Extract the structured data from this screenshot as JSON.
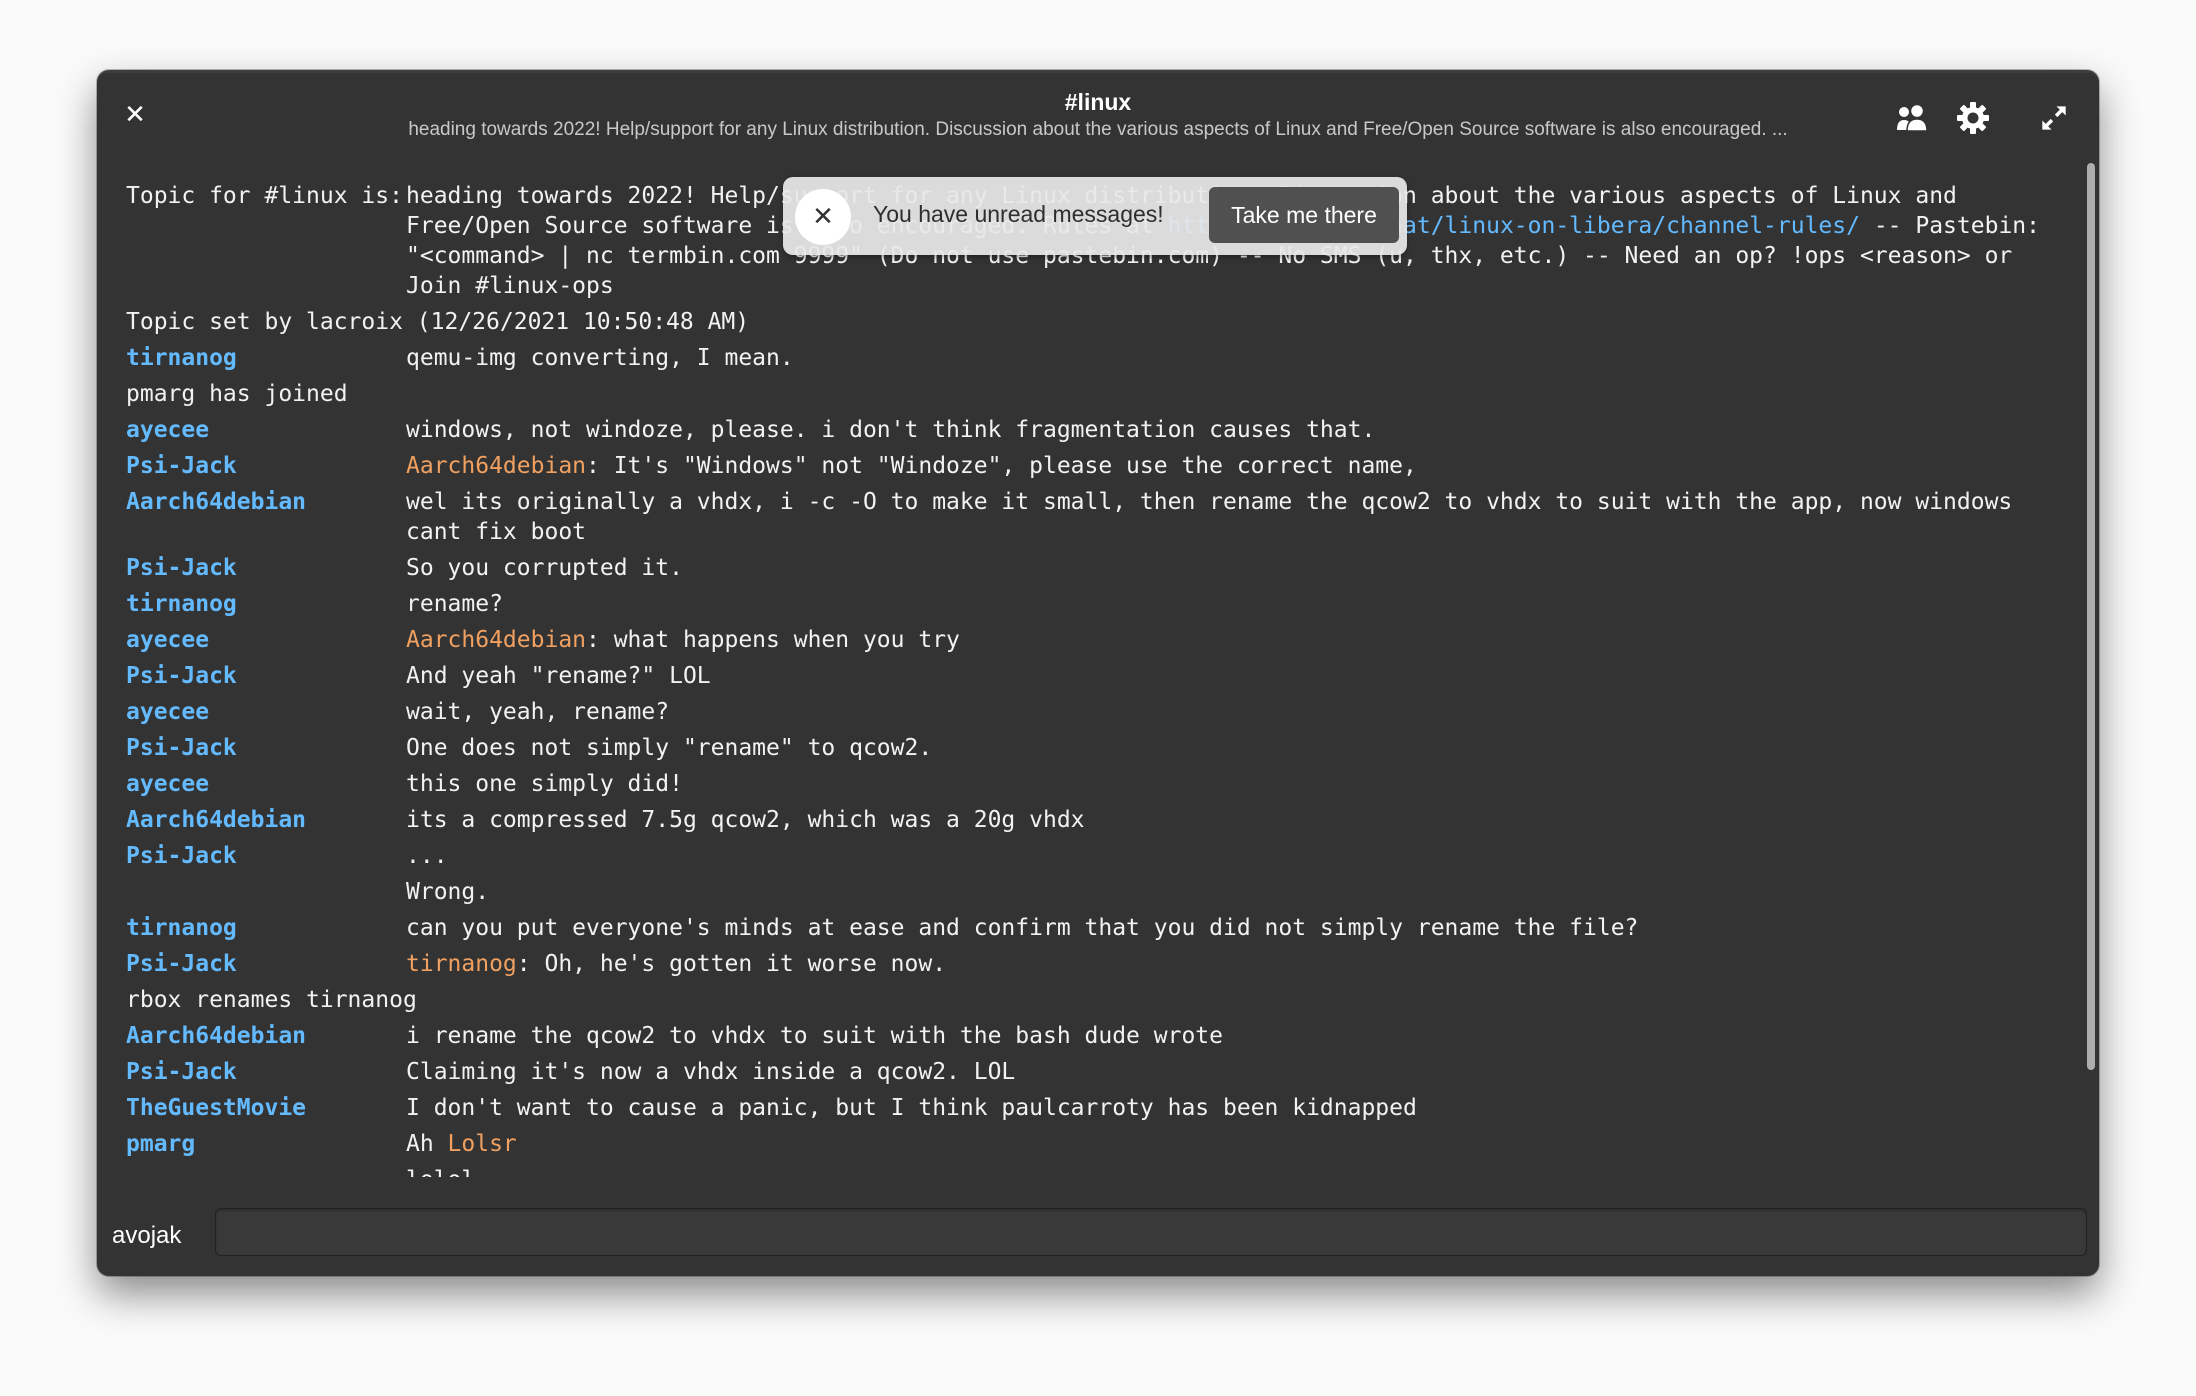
{
  "window": {
    "title": "#linux",
    "subtitle": "heading towards 2022! Help/support for any Linux distribution. Discussion about the various aspects of Linux and Free/Open Source software is also encouraged. ...",
    "close_icon": "close-icon",
    "members_icon": "people-icon",
    "settings_icon": "gear-icon",
    "fullscreen_icon": "expand-icon"
  },
  "colors": {
    "background": "#333333",
    "nick": "#64baff",
    "mention": "#f0a060",
    "link": "#64baff",
    "text": "#f2f2f2"
  },
  "topic": {
    "label": "Topic for #linux is:",
    "text_before_link": "heading towards 2022! Help/support for any Linux distribution. Discussion about the various aspects of Linux and Free/Open Source software is also encouraged. Rules at ",
    "link": "https://libera.chat/linux-on-libera/channel-rules/",
    "text_after_link": " -- Pastebin: \"<command> | nc termbin.com 9999\" (Do not use pastebin.com) -- No SMS (u, thx, etc.) -- Need an op? !ops <reason> or Join #linux-ops",
    "set_by": "Topic set by lacroix (12/26/2021 10:50:48 AM)"
  },
  "messages": [
    {
      "nick": "tirnanog",
      "mention": "",
      "text": "qemu-img converting, I mean."
    },
    {
      "event": "pmarg has joined"
    },
    {
      "nick": "ayecee",
      "mention": "",
      "text": "windows, not windoze, please. i don't think fragmentation causes that."
    },
    {
      "nick": "Psi-Jack",
      "mention": "Aarch64debian",
      "text": ": It's \"Windows\" not \"Windoze\", please use the correct name,"
    },
    {
      "nick": "Aarch64debian",
      "mention": "",
      "text": "wel its originally a vhdx, i -c -O to make it small, then rename the qcow2 to vhdx to suit with the app, now windows cant fix boot"
    },
    {
      "nick": "Psi-Jack",
      "mention": "",
      "text": "So you corrupted it."
    },
    {
      "nick": "tirnanog",
      "mention": "",
      "text": "rename?"
    },
    {
      "nick": "ayecee",
      "mention": "Aarch64debian",
      "text": ": what happens when you try"
    },
    {
      "nick": "Psi-Jack",
      "mention": "",
      "text": "And yeah \"rename?\" LOL"
    },
    {
      "nick": "ayecee",
      "mention": "",
      "text": "wait, yeah, rename?"
    },
    {
      "nick": "Psi-Jack",
      "mention": "",
      "text": "One does not simply \"rename\" to qcow2."
    },
    {
      "nick": "ayecee",
      "mention": "",
      "text": "this one simply did!"
    },
    {
      "nick": "Aarch64debian",
      "mention": "",
      "text": "its a compressed 7.5g qcow2, which was a 20g vhdx"
    },
    {
      "nick": "Psi-Jack",
      "mention": "",
      "text": "..."
    },
    {
      "nick": "",
      "mention": "",
      "text": "Wrong."
    },
    {
      "nick": "tirnanog",
      "mention": "",
      "text": "can you put everyone's minds at ease and confirm that you did not simply rename the file?"
    },
    {
      "nick": "Psi-Jack",
      "mention": "tirnanog",
      "text": ": Oh, he's gotten it worse now."
    },
    {
      "event": "rbox renames tirnanog"
    },
    {
      "nick": "Aarch64debian",
      "mention": "",
      "text": "i rename the qcow2 to vhdx to suit with the bash dude wrote"
    },
    {
      "nick": "Psi-Jack",
      "mention": "",
      "text": "Claiming it's now a vhdx inside a qcow2. LOL"
    },
    {
      "nick": "TheGuestMovie",
      "mention": "",
      "text": "I don't want to cause a panic, but I think paulcarroty has been kidnapped"
    },
    {
      "nick": "pmarg",
      "mention": "",
      "text": "Ah ",
      "trailing_mention": "Lolsr"
    }
  ],
  "partial_line": "lolol",
  "toast": {
    "text": "You have unread messages!",
    "button": "Take me there",
    "close_icon": "close-icon"
  },
  "footer": {
    "username": "avojak",
    "input_value": "",
    "input_placeholder": ""
  }
}
